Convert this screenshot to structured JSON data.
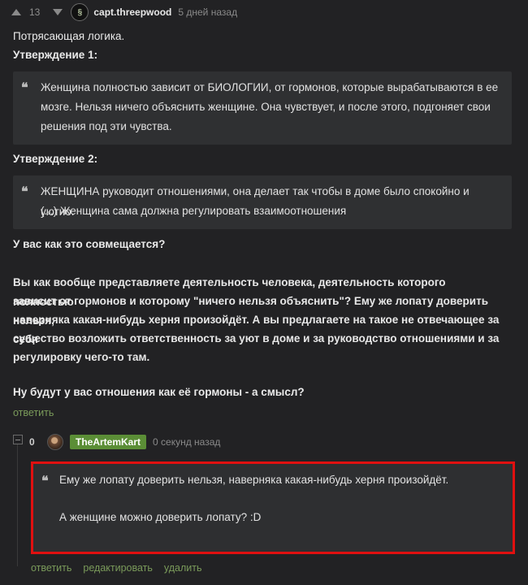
{
  "comment": {
    "rating": "13",
    "author": "capt.threepwood",
    "time": "5 дней назад",
    "lines": [
      "Потрясающая логика.",
      "Утверждение 1:"
    ],
    "quote1": [
      "Женщина полностью зависит от БИОЛОГИИ, от гормонов, которые вырабатываются в ее",
      "мозге. Нельзя ничего объяснить женщине. Она чувствует, и после этого, подгоняет свои",
      "решения под эти чувства."
    ],
    "statement2": "Утверждение 2:",
    "quote2": [
      "ЖЕНЩИНА руководит отношениями, она делает так чтобы в доме было спокойно и уютно.",
      "(...) Женщина сама должна регулировать взаимоотношения"
    ],
    "question": "У вас как это совмещается?",
    "paragraph": [
      "Вы как вообще представляете деятельность человека, деятельность которого полностью",
      "зависит от гормонов и которому \"ничего нельзя объяснить\"? Ему же лопату доверить нельзя,",
      "наверняка какая-нибудь херня произойдёт. А вы предлагаете на такое не отвечающее за себя",
      "существо возложить ответственность за уют в доме и за руководство отношениями и за",
      "регулировку чего-то там."
    ],
    "closing": "Ну будут у вас отношения как её гормоны - а смысл?",
    "reply_label": "ответить"
  },
  "reply": {
    "rating": "0",
    "author": "TheArtemKart",
    "time": "0 секунд назад",
    "quote_line": "Ему же лопату доверить нельзя, наверняка какая-нибудь херня произойдёт.",
    "text_line": "А женщине можно доверить лопату? :D",
    "actions": {
      "reply": "ответить",
      "edit": "редактировать",
      "delete": "удалить"
    }
  },
  "colors": {
    "background": "#222224",
    "quote_bg": "#2f3032",
    "link_green": "#7a9a5a",
    "badge_green": "#5b8e36",
    "highlight_red": "#e01010"
  },
  "icons": {
    "upvote": "triangle-up-icon",
    "downvote": "triangle-down-icon",
    "quote": "quote-icon",
    "collapse": "minus-box-icon"
  }
}
